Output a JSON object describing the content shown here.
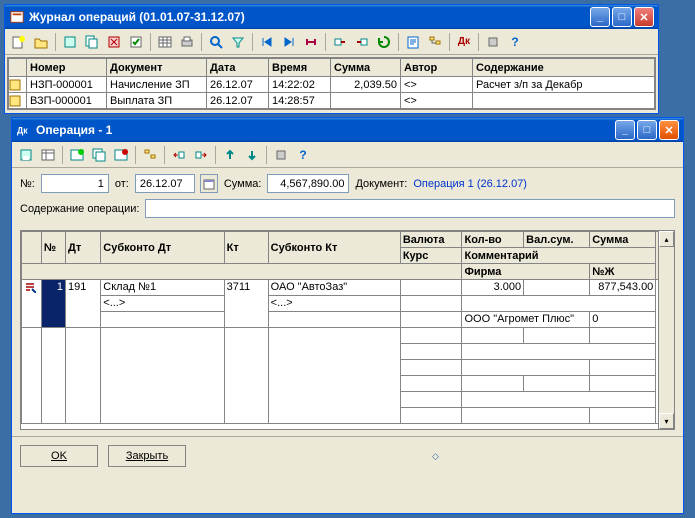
{
  "journal": {
    "title": "Журнал операций (01.01.07-31.12.07)",
    "columns": [
      "Номер",
      "Документ",
      "Дата",
      "Время",
      "Сумма",
      "Автор",
      "Содержание"
    ],
    "rows": [
      {
        "no": "НЗП-000001",
        "doc": "Начисление ЗП",
        "date": "26.12.07",
        "time": "14:22:02",
        "sum": "2,039.50",
        "author": "<>",
        "text": "Расчет з/п за Декабр"
      },
      {
        "no": "ВЗП-000001",
        "doc": "Выплата ЗП",
        "date": "26.12.07",
        "time": "14:28:57",
        "sum": "",
        "author": "<>",
        "text": ""
      }
    ]
  },
  "op": {
    "title": "Операция - 1",
    "labels": {
      "no": "№:",
      "ot": "от:",
      "sum": "Сумма:",
      "doc": "Документ:",
      "content": "Содержание операции:"
    },
    "values": {
      "no": "1",
      "date": "26.12.07",
      "sum": "4,567,890.00",
      "doclink": "Операция 1 (26.12.07)",
      "content": ""
    },
    "columns": {
      "no": "№",
      "dt": "Дт",
      "subdt": "Субконто Дт",
      "kt": "Кт",
      "subkt": "Субконто Кт",
      "val": "Валюта",
      "kurs": "Курс",
      "qty": "Кол-во",
      "vsum": "Вал.сум.",
      "summa": "Сумма",
      "comment": "Комментарий",
      "firm": "Фирма",
      "nz": "№Ж"
    },
    "row": {
      "n": "1",
      "dt": "191",
      "subdt1": "Склад №1",
      "subdt2": "<...>",
      "kt": "3711",
      "subkt1": "ОАО \"АвтоЗаз\"",
      "subkt2": "<...>",
      "qty": "3.000",
      "summa": "877,543.00",
      "firm": "ООО \"Агромет Плюс\"",
      "nz": "0"
    },
    "buttons": {
      "ok": "OK",
      "close": "Закрыть"
    }
  }
}
